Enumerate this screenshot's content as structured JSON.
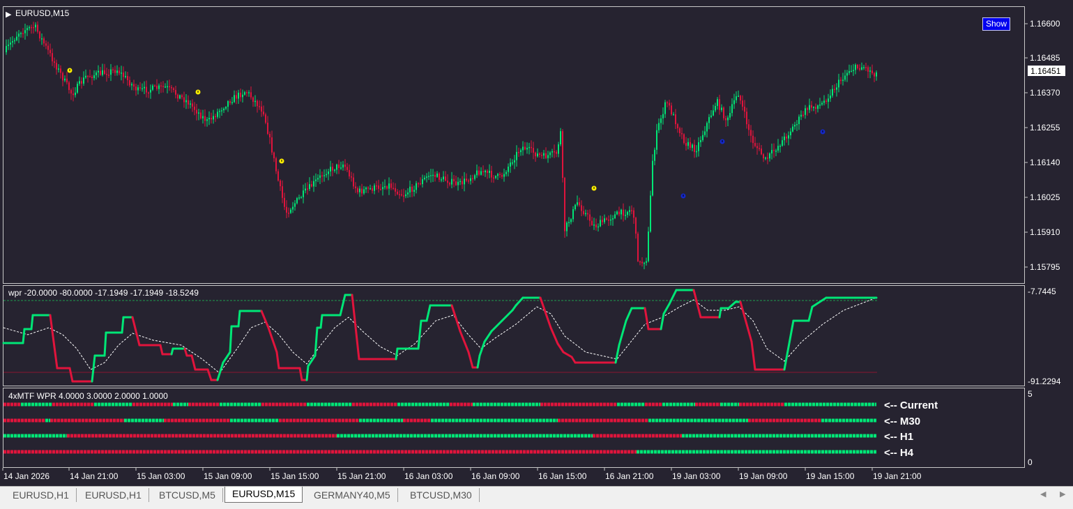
{
  "main_chart": {
    "title": "EURUSD,M15",
    "show_button": "Show",
    "price_axis": [
      "1.16600",
      "1.16485",
      "1.16370",
      "1.16255",
      "1.16140",
      "1.16025",
      "1.15910",
      "1.15795"
    ],
    "current_price": "1.16451",
    "arrow_marker": "▶"
  },
  "wpr_panel": {
    "header": "wpr  -20.0000 -80.0000 -17.1949 -17.1949 -18.5249",
    "axis_top": "-7.7445",
    "axis_bottom": "-91.2294"
  },
  "mtf_panel": {
    "header": "4xMTF WPR  4.0000 3.0000 2.0000 1.0000",
    "axis_top": "5",
    "axis_bottom": "0",
    "rows": [
      {
        "label": "<-- Current"
      },
      {
        "label": "<-- M30"
      },
      {
        "label": "<-- H1"
      },
      {
        "label": "<-- H4"
      }
    ]
  },
  "time_axis": [
    "14 Jan 2026",
    "14 Jan 21:00",
    "15 Jan 03:00",
    "15 Jan 09:00",
    "15 Jan 15:00",
    "15 Jan 21:00",
    "16 Jan 03:00",
    "16 Jan 09:00",
    "16 Jan 15:00",
    "16 Jan 21:00",
    "19 Jan 03:00",
    "19 Jan 09:00",
    "19 Jan 15:00",
    "19 Jan 21:00"
  ],
  "tabs": [
    {
      "label": "EURUSD,H1",
      "active": false
    },
    {
      "label": "EURUSD,H1",
      "active": false
    },
    {
      "label": "BTCUSD,M5",
      "active": false
    },
    {
      "label": "EURUSD,M15",
      "active": true
    },
    {
      "label": "GERMANY40,M5",
      "active": false
    },
    {
      "label": "BTCUSD,M30",
      "active": false
    }
  ],
  "colors": {
    "background": "#262330",
    "bull": "#00e676",
    "bear": "#e0143c",
    "marker_yellow": "#ffee00",
    "marker_blue": "#1428c8"
  }
}
